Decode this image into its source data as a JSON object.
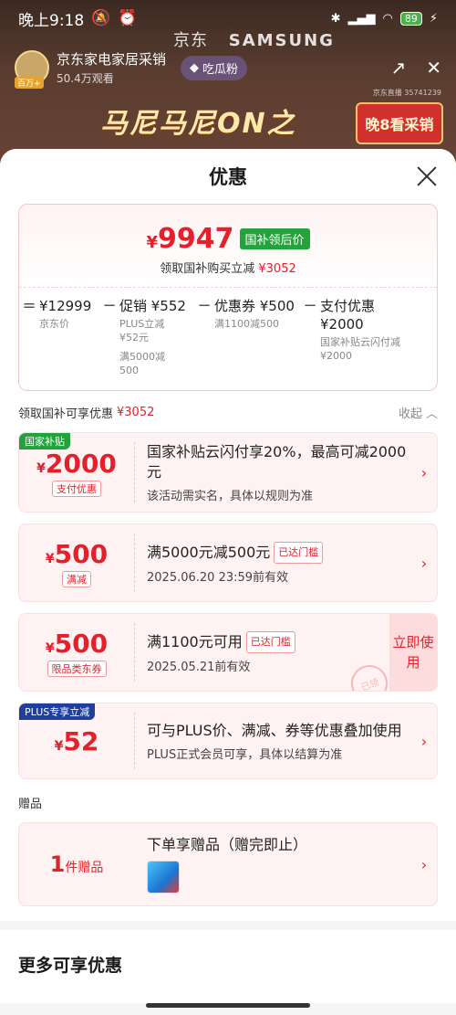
{
  "status_bar": {
    "time": "晚上9:18",
    "battery": "89"
  },
  "live": {
    "brand_jd": "京东",
    "brand_samsung": "SAMSUNG",
    "avatar_tag": "百万+",
    "name": "京东家电家居采销",
    "viewers": "50.4万观看",
    "follow_label": "吃瓜粉",
    "room_id": "京东直播 35741239",
    "banner_text": "马尼马尼ON之",
    "banner_button": "晚8看采销"
  },
  "sheet": {
    "title": "优惠",
    "final_price_symbol": "¥",
    "final_price": "9947",
    "final_tag": "国补领后价",
    "final_sub_label": "领取国补购买立减",
    "final_sub_value": "¥3052",
    "breakdown": [
      {
        "op": "=",
        "main": "¥12999",
        "notes": [
          "京东价"
        ]
      },
      {
        "op": "−",
        "main": "促销 ¥552",
        "notes": [
          "PLUS立减",
          "¥52元",
          "满5000减",
          "500"
        ]
      },
      {
        "op": "−",
        "main": "优惠券 ¥500",
        "notes": [
          "满1100减500"
        ]
      },
      {
        "op": "−",
        "main": "支付优惠 ¥2000",
        "notes": [
          "国家补贴云闪付减",
          "¥2000"
        ]
      }
    ],
    "section_label": "领取国补可享优惠",
    "section_value": "¥3052",
    "collapse_label": "收起"
  },
  "coupons": [
    {
      "corner": "国家补贴",
      "corner_color": "#1fa33a",
      "amount": "2000",
      "kind": "支付优惠",
      "title": "国家补贴云闪付享20%，最高可减2000元",
      "sub": "该活动需实名，具体以规则为准"
    },
    {
      "amount": "500",
      "kind": "满减",
      "title": "满5000元减500元",
      "reached": "已达门槛",
      "sub": "2025.06.20 23:59前有效"
    },
    {
      "amount": "500",
      "kind": "限品类东券",
      "title": "满1100元可用",
      "reached": "已达门槛",
      "sub": "2025.05.21前有效",
      "claim": "立即使用",
      "stamp": "已领"
    },
    {
      "corner": "PLUS专享立减",
      "corner_color": "#1e3f9e",
      "amount": "52",
      "title": "可与PLUS价、满减、券等优惠叠加使用",
      "sub": "PLUS正式会员可享，具体以结算为准"
    }
  ],
  "gifts": {
    "label": "赠品",
    "count": "1",
    "count_unit": "件赠品",
    "title": "下单享赠品（赠完即止）"
  },
  "more": {
    "title": "更多可享优惠"
  },
  "currency": "¥",
  "accent": "#e4212b"
}
